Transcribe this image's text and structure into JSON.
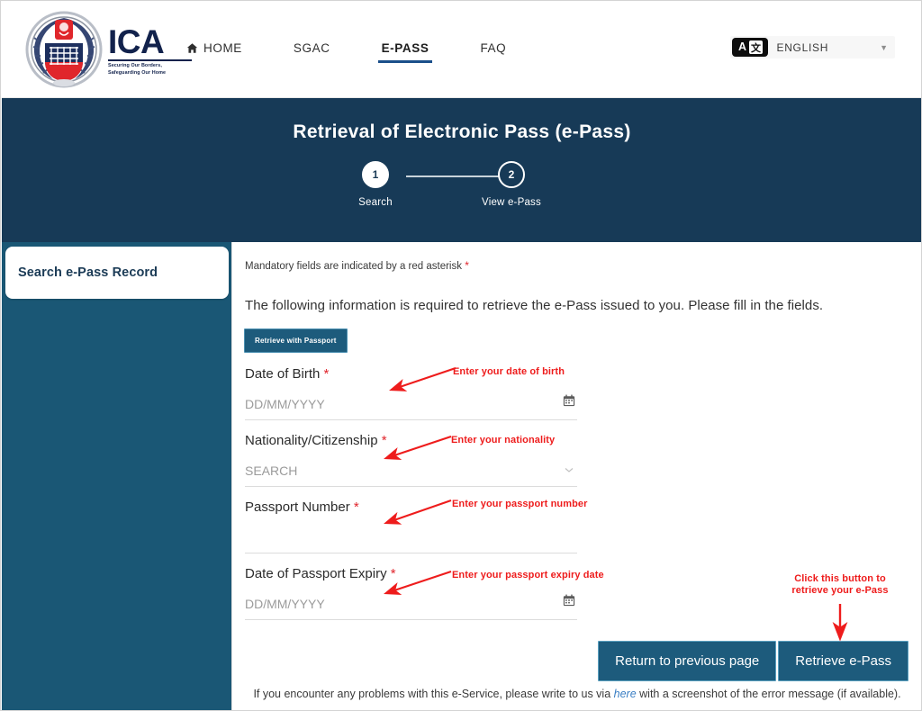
{
  "header": {
    "brand": {
      "acronym": "ICA",
      "tagline": "Securing Our Borders,\nSafeguarding Our Home",
      "crest_icon": "ica-crest-icon"
    },
    "nav": [
      {
        "label": "HOME",
        "icon": "home-icon",
        "active": false
      },
      {
        "label": "SGAC",
        "icon": "",
        "active": false
      },
      {
        "label": "E-PASS",
        "icon": "",
        "active": true
      },
      {
        "label": "FAQ",
        "icon": "",
        "active": false
      }
    ],
    "language": {
      "badge_left": "A",
      "badge_right": "文",
      "label": "ENGLISH",
      "caret": "▼",
      "icon": "translate-icon"
    }
  },
  "banner": {
    "title": "Retrieval of Electronic Pass (e-Pass)",
    "steps": [
      {
        "number": "1",
        "label": "Search",
        "state": "active"
      },
      {
        "number": "2",
        "label": "View e-Pass",
        "state": "inactive"
      }
    ]
  },
  "sidebar": {
    "items": [
      {
        "label": "Search e-Pass Record",
        "active": true
      }
    ]
  },
  "main": {
    "mandatory_note": "Mandatory fields are indicated by a red asterisk",
    "asterisk": "*",
    "intro": "The following information is required to retrieve the e-Pass issued to you. Please fill in the fields.",
    "retrieve_with_passport_label": "Retrieve with Passport",
    "fields": [
      {
        "label": "Date of Birth",
        "required": true,
        "value": "",
        "placeholder": "DD/MM/YYYY",
        "control": "date",
        "icon": "calendar-icon"
      },
      {
        "label": "Nationality/Citizenship",
        "required": true,
        "value": "",
        "placeholder": "SEARCH",
        "control": "select",
        "icon": "chevron-down-icon"
      },
      {
        "label": "Passport Number",
        "required": true,
        "value": "",
        "placeholder": "",
        "control": "text",
        "icon": ""
      },
      {
        "label": "Date of Passport Expiry",
        "required": true,
        "value": "",
        "placeholder": "DD/MM/YYYY",
        "control": "date",
        "icon": "calendar-icon"
      }
    ],
    "buttons": {
      "back_label": "Return to previous page",
      "submit_label": "Retrieve e-Pass"
    },
    "footer": {
      "before_link": "If you encounter any problems with this e-Service, please write to us via ",
      "link_text": "here",
      "after_link": " with a screenshot of the error message (if available)."
    }
  },
  "annotations": [
    {
      "text": "Enter your date of birth",
      "target": "date-of-birth-input"
    },
    {
      "text": "Enter your nationality",
      "target": "nationality-input"
    },
    {
      "text": "Enter your passport number",
      "target": "passport-number-input"
    },
    {
      "text": "Enter your passport expiry date",
      "target": "passport-expiry-input"
    },
    {
      "text_line1": "Click this button to",
      "text_line2": "retrieve your e-Pass",
      "target": "retrieve-epass-button"
    }
  ],
  "colors": {
    "banner_navy": "#173A57",
    "sidebar_teal": "#1A5775",
    "button_blue": "#1D5B7C",
    "annotation_red": "#EE1C1C",
    "required_red": "#E0242B",
    "link_blue": "#3B7FC4",
    "nav_active_underline": "#1B4F8A"
  }
}
